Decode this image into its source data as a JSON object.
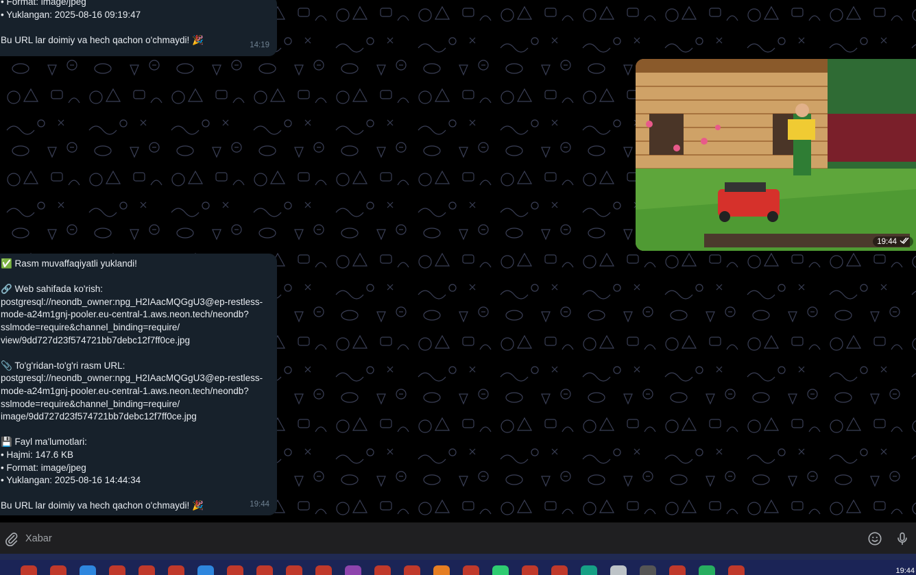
{
  "messages": {
    "top": {
      "lines": [
        "• Format: image/jpeg",
        "• Yuklangan: 2025-08-16 09:19:47",
        "",
        "Bu URL lar doimiy va hech qachon o'chmaydi! 🎉"
      ],
      "time": "14:19"
    },
    "photo": {
      "time": "19:44",
      "status_icon": "double-check-icon"
    },
    "bottom": {
      "lines": [
        "✅ Rasm muvaffaqiyatli yuklandi!",
        "",
        "🔗 Web sahifada ko'rish:",
        "postgresql://neondb_owner:npg_H2IAacMQGgU3@ep-restless-",
        "mode-a24m1gnj-pooler.eu-central-1.aws.neon.tech/neondb?",
        "sslmode=require&channel_binding=require/",
        "view/9dd727d23f574721bb7debc12f7ff0ce.jpg",
        "",
        "📎 To'g'ridan-to'g'ri rasm URL:",
        "postgresql://neondb_owner:npg_H2IAacMQGgU3@ep-restless-",
        "mode-a24m1gnj-pooler.eu-central-1.aws.neon.tech/neondb?",
        "sslmode=require&channel_binding=require/",
        "image/9dd727d23f574721bb7debc12f7ff0ce.jpg",
        "",
        "💾 Fayl ma'lumotlari:",
        "• Hajmi: 147.6 KB",
        "• Format: image/jpeg",
        "• Yuklangan: 2025-08-16 14:44:34",
        "",
        "Bu URL lar doimiy va hech qachon o'chmaydi! 🎉"
      ],
      "time": "19:44"
    }
  },
  "composer": {
    "placeholder": "Xabar",
    "attach_icon": "paperclip-icon",
    "emoji_icon": "smiley-icon",
    "mic_icon": "microphone-icon"
  },
  "taskbar": {
    "clock": "19:44",
    "app_colors": [
      "#c0392b",
      "#c0392b",
      "#2e86de",
      "#c0392b",
      "#c0392b",
      "#c0392b",
      "#2e86de",
      "#c0392b",
      "#c0392b",
      "#c0392b",
      "#c0392b",
      "#8e44ad",
      "#c0392b",
      "#c0392b",
      "#e67e22",
      "#c0392b",
      "#2ecc71",
      "#c0392b",
      "#c0392b",
      "#16a085",
      "#bdc3c7",
      "#555555",
      "#c0392b",
      "#27ae60",
      "#c0392b"
    ]
  },
  "colors": {
    "bubble": "#17212b",
    "composer": "#1f1f21",
    "taskbar": "#1b2456"
  }
}
